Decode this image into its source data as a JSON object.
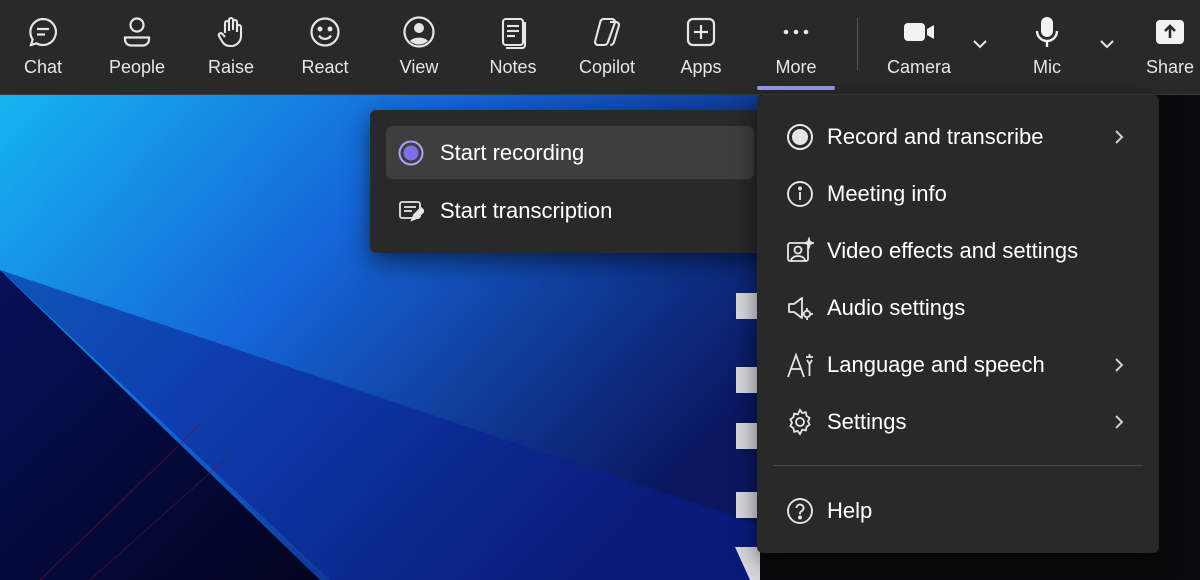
{
  "toolbar": {
    "items": [
      {
        "label": "Chat",
        "icon": "chat-icon"
      },
      {
        "label": "People",
        "icon": "people-icon"
      },
      {
        "label": "Raise",
        "icon": "raise-hand-icon"
      },
      {
        "label": "React",
        "icon": "smile-icon"
      },
      {
        "label": "View",
        "icon": "view-icon"
      },
      {
        "label": "Notes",
        "icon": "notes-icon"
      },
      {
        "label": "Copilot",
        "icon": "copilot-icon"
      },
      {
        "label": "Apps",
        "icon": "apps-plus-icon"
      },
      {
        "label": "More",
        "icon": "more-dots-icon",
        "selected": true
      },
      {
        "label": "Camera",
        "icon": "camera-icon"
      },
      {
        "label": "Mic",
        "icon": "mic-icon"
      },
      {
        "label": "Share",
        "icon": "share-icon"
      }
    ]
  },
  "submenu": {
    "items": [
      {
        "label": "Start recording",
        "icon": "record-icon",
        "highlighted": true
      },
      {
        "label": "Start transcription",
        "icon": "transcription-icon"
      }
    ]
  },
  "menu": {
    "items": [
      {
        "label": "Record and transcribe",
        "icon": "record-circle-icon",
        "has_submenu": true
      },
      {
        "label": "Meeting info",
        "icon": "info-icon",
        "has_submenu": false
      },
      {
        "label": "Video effects and settings",
        "icon": "video-effects-icon",
        "has_submenu": false
      },
      {
        "label": "Audio settings",
        "icon": "audio-settings-icon",
        "has_submenu": false
      },
      {
        "label": "Language and speech",
        "icon": "language-icon",
        "has_submenu": true
      },
      {
        "label": "Settings",
        "icon": "gear-icon",
        "has_submenu": true
      },
      {
        "label": "Help",
        "icon": "help-icon",
        "has_submenu": false
      }
    ]
  },
  "colors": {
    "toolbar_bg": "#292929",
    "menu_bg": "#292929",
    "accent": "#9b97f0",
    "record_accent": "#7b72e9"
  }
}
